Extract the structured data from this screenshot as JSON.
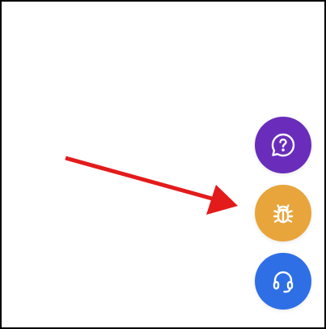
{
  "colors": {
    "background": "#ffffff",
    "border": "#000000",
    "annotation_arrow": "#e31b1b"
  },
  "buttons": [
    {
      "id": "help",
      "icon": "question-chat-icon",
      "color": "#6a2dbb"
    },
    {
      "id": "bug",
      "icon": "bug-icon",
      "color": "#e8a53b"
    },
    {
      "id": "support",
      "icon": "headset-icon",
      "color": "#2f6fe6"
    }
  ]
}
